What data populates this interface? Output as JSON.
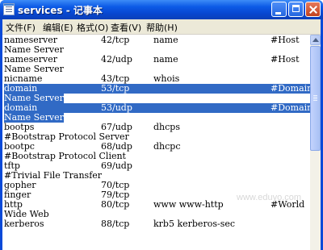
{
  "window": {
    "title": "services - 记事本",
    "icon": "notepad-icon",
    "buttons": {
      "minimize": "minimize-icon",
      "maximize": "maximize-icon",
      "close": "close-icon"
    }
  },
  "menu": {
    "items": [
      {
        "label": "文件(F)"
      },
      {
        "label": "编辑(E)"
      },
      {
        "label": "格式(O)"
      },
      {
        "label": "查看(V)"
      },
      {
        "label": "帮助(H)"
      }
    ]
  },
  "lines": [
    [
      "nameserver",
      "42/tcp",
      "name",
      "#Host"
    ],
    [
      "Name Server",
      "",
      "",
      ""
    ],
    [
      "nameserver",
      "42/udp",
      "name",
      "#Host"
    ],
    [
      "Name Server",
      "",
      "",
      ""
    ],
    [
      "nicname",
      "43/tcp",
      "whois",
      ""
    ],
    [
      "domain",
      "53/tcp",
      "",
      "#Domain"
    ],
    [
      "Name Server",
      "",
      "",
      ""
    ],
    [
      "domain",
      "53/udp",
      "",
      "#Domain"
    ],
    [
      "Name Server",
      "",
      "",
      ""
    ],
    [
      "bootps",
      "67/udp",
      "dhcps",
      ""
    ],
    [
      "#Bootstrap Protocol Server",
      "",
      "",
      ""
    ],
    [
      "bootpc",
      "68/udp",
      "dhcpc",
      ""
    ],
    [
      "#Bootstrap Protocol Client",
      "",
      "",
      ""
    ],
    [
      "tftp",
      "69/udp",
      "",
      ""
    ],
    [
      "#Trivial File Transfer",
      "",
      "",
      ""
    ],
    [
      "gopher",
      "70/tcp",
      "",
      ""
    ],
    [
      "finger",
      "79/tcp",
      "",
      ""
    ],
    [
      "http",
      "80/tcp",
      "www www-http",
      "#World"
    ],
    [
      "Wide Web",
      "",
      "",
      ""
    ],
    [
      "kerberos",
      "88/tcp",
      "krb5 kerberos-sec",
      ""
    ]
  ],
  "watermark": "www.eduyo.com",
  "colors": {
    "titlebar": "#0c5ae6",
    "selection": "#316ac5",
    "menubar": "#ece9d8"
  }
}
